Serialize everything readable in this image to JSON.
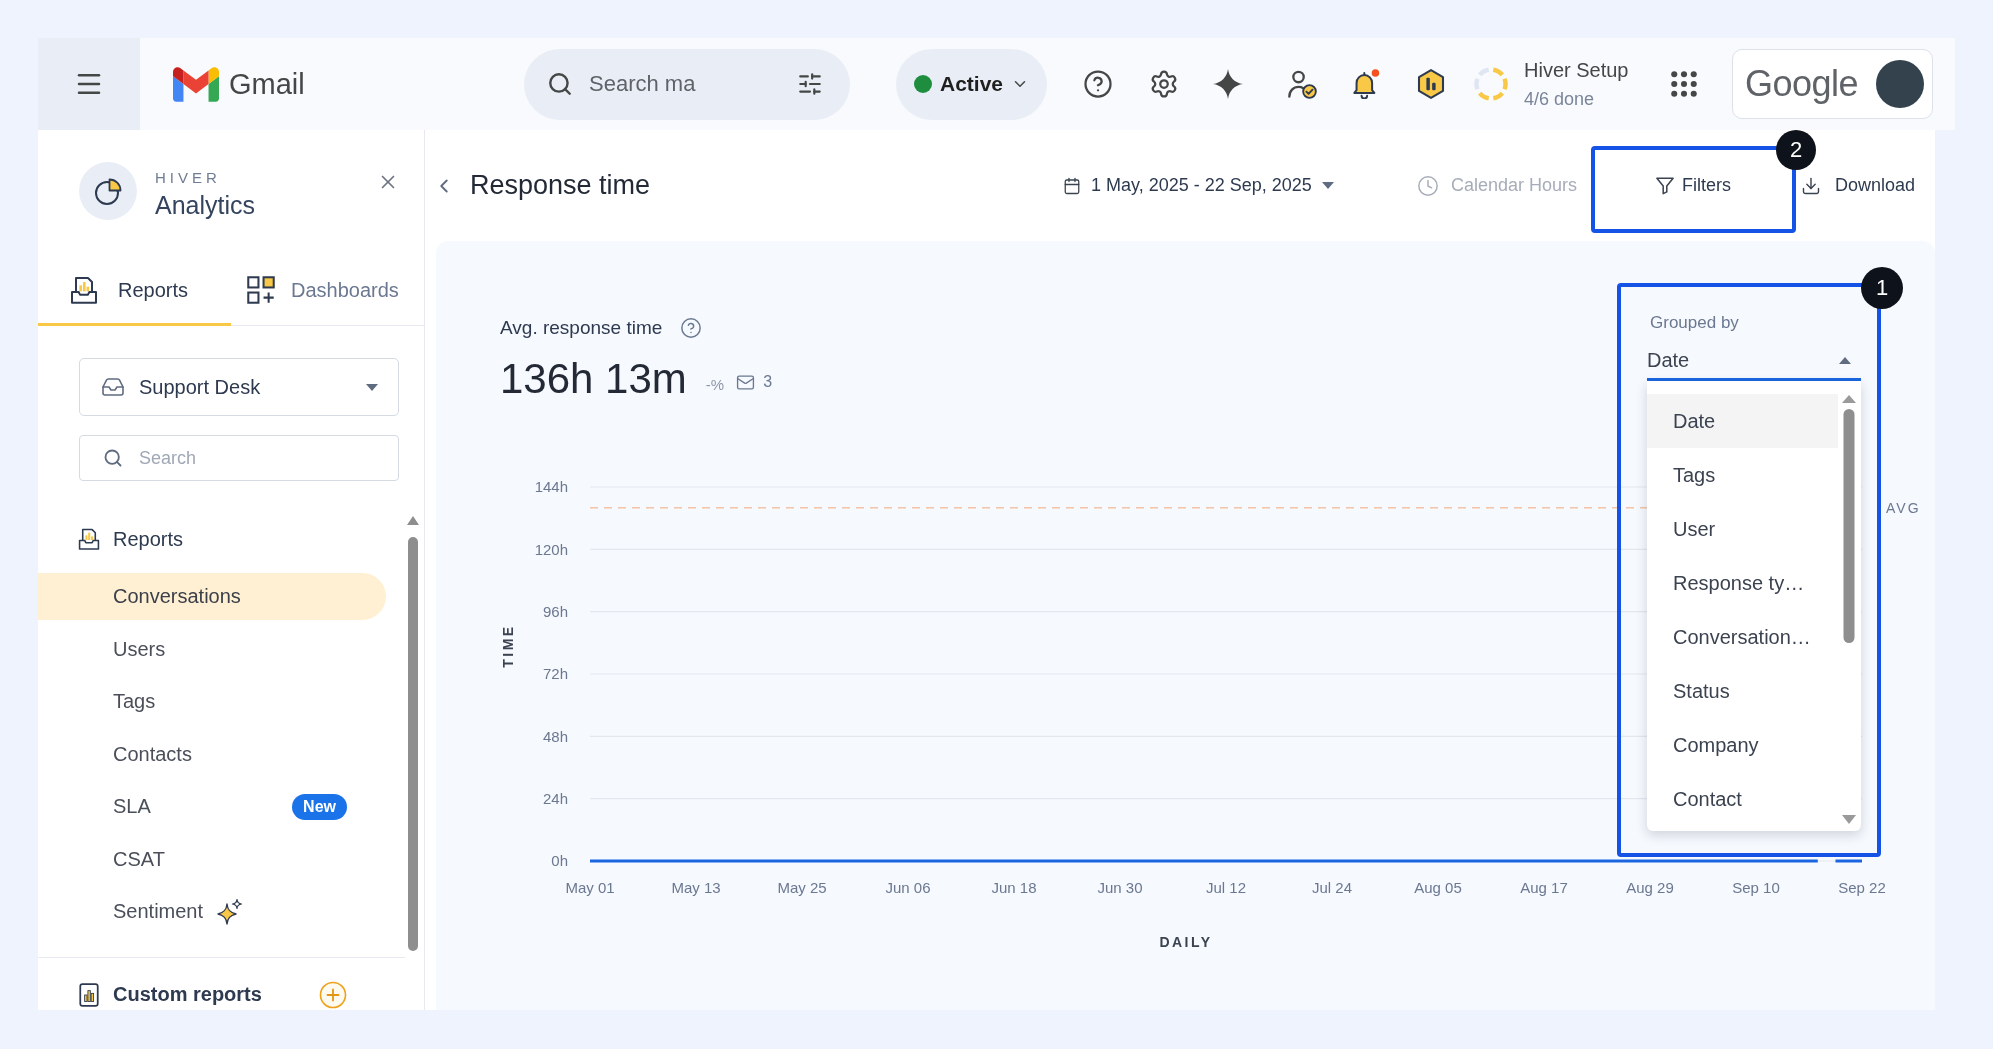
{
  "topbar": {
    "app_name": "Gmail",
    "search": {
      "placeholder": "Search ma"
    },
    "status": {
      "label": "Active",
      "online": true
    },
    "notifications": {
      "unread": true
    },
    "setup": {
      "title": "Hiver Setup",
      "progress": "4/6 done",
      "level": 0.667
    },
    "account": {
      "logo_text": "Google"
    }
  },
  "sidebar": {
    "brand": {
      "kicker": "HIVER",
      "title": "Analytics"
    },
    "tabs": [
      {
        "label": "Reports",
        "selected": true
      },
      {
        "label": "Dashboards",
        "selected": false
      }
    ],
    "inbox_select": {
      "value": "Support Desk"
    },
    "search": {
      "placeholder": "Search"
    },
    "section": {
      "title": "Reports",
      "items": [
        {
          "label": "Conversations",
          "selected": true,
          "sparkle": false
        },
        {
          "label": "Users",
          "selected": false,
          "sparkle": false
        },
        {
          "label": "Tags",
          "selected": false,
          "sparkle": false
        },
        {
          "label": "Contacts",
          "selected": false,
          "sparkle": false
        },
        {
          "label": "SLA",
          "selected": false,
          "sparkle": false,
          "badge": "New"
        },
        {
          "label": "CSAT",
          "selected": false,
          "sparkle": false
        },
        {
          "label": "Sentiment",
          "selected": false,
          "sparkle": true
        }
      ]
    },
    "custom_reports": {
      "title": "Custom reports"
    }
  },
  "report": {
    "title": "Response time",
    "date_range": "1 May, 2025 - 22 Sep, 2025",
    "hours": {
      "label": "Calendar Hours",
      "disabled": true
    },
    "actions": [
      {
        "label": "Filters"
      },
      {
        "label": "Download"
      }
    ]
  },
  "metric": {
    "title": "Avg. response time",
    "value": "136h 13m",
    "change": "-%",
    "count": "3"
  },
  "grouping": {
    "label": "Grouped by",
    "value": "Date",
    "expanded": true,
    "options": [
      {
        "label": "Date",
        "selected": true
      },
      {
        "label": "Tags",
        "selected": false
      },
      {
        "label": "User",
        "selected": false
      },
      {
        "label": "Response ty…",
        "selected": false
      },
      {
        "label": "Conversation…",
        "selected": false
      },
      {
        "label": "Status",
        "selected": false
      },
      {
        "label": "Company",
        "selected": false
      },
      {
        "label": "Contact",
        "selected": false
      }
    ]
  },
  "chart_data": {
    "type": "line",
    "xlabel": "DAILY",
    "ylabel": "TIME",
    "grid": true,
    "categories": [
      "May 01",
      null,
      null,
      null,
      null,
      null,
      null,
      null,
      null,
      null,
      null,
      null,
      "May 13",
      null,
      null,
      null,
      null,
      null,
      null,
      null,
      null,
      null,
      null,
      null,
      "May 25",
      null,
      null,
      null,
      null,
      null,
      null,
      null,
      null,
      null,
      null,
      null,
      "Jun 06",
      null,
      null,
      null,
      null,
      null,
      null,
      null,
      null,
      null,
      null,
      null,
      "Jun 18",
      null,
      null,
      null,
      null,
      null,
      null,
      null,
      null,
      null,
      null,
      null,
      "Jun 30",
      null,
      null,
      null,
      null,
      null,
      null,
      null,
      null,
      null,
      null,
      null,
      "Jul 12",
      null,
      null,
      null,
      null,
      null,
      null,
      null,
      null,
      null,
      null,
      null,
      "Jul 24",
      null,
      null,
      null,
      null,
      null,
      null,
      null,
      null,
      null,
      null,
      null,
      "Aug 05",
      null,
      null,
      null,
      null,
      null,
      null,
      null,
      null,
      null,
      null,
      null,
      "Aug 17",
      null,
      null,
      null,
      null,
      null,
      null,
      null,
      null,
      null,
      null,
      null,
      "Aug 29",
      null,
      null,
      null,
      null,
      null,
      null,
      null,
      null,
      null,
      null,
      null,
      "Sep 10",
      null,
      null,
      null,
      null,
      null,
      null,
      null,
      null,
      null,
      null,
      null,
      "Sep 22"
    ],
    "ylim": [
      0,
      144
    ],
    "yticks": [
      {
        "value": 0,
        "label": "0h"
      },
      {
        "value": 24,
        "label": "24h"
      },
      {
        "value": 48,
        "label": "48h"
      },
      {
        "value": 72,
        "label": "72h"
      },
      {
        "value": 96,
        "label": "96h"
      },
      {
        "value": 120,
        "label": "120h"
      },
      {
        "value": 144,
        "label": "144h"
      }
    ],
    "series": [
      {
        "color": "#1a66e0",
        "values": [
          0,
          0,
          0,
          0,
          0,
          0,
          0,
          0,
          0,
          0,
          0,
          0,
          0,
          0,
          0,
          0,
          0,
          0,
          0,
          0,
          0,
          0,
          0,
          0,
          0,
          0,
          0,
          0,
          0,
          0,
          0,
          0,
          0,
          0,
          0,
          0,
          0,
          0,
          0,
          0,
          0,
          0,
          0,
          0,
          0,
          0,
          0,
          0,
          0,
          0,
          0,
          0,
          0,
          0,
          0,
          0,
          0,
          0,
          0,
          0,
          0,
          0,
          0,
          0,
          0,
          0,
          0,
          0,
          0,
          0,
          0,
          0,
          0,
          0,
          0,
          0,
          0,
          0,
          0,
          0,
          0,
          0,
          0,
          0,
          0,
          0,
          0,
          0,
          0,
          0,
          0,
          0,
          0,
          0,
          0,
          0,
          0,
          0,
          0,
          0,
          0,
          0,
          0,
          0,
          0,
          0,
          0,
          0,
          0,
          0,
          0,
          0,
          0,
          0,
          0,
          0,
          0,
          0,
          0,
          0,
          0,
          0,
          0,
          0,
          0,
          0,
          0,
          0,
          0,
          0,
          0,
          0,
          0,
          0,
          0,
          0,
          0,
          0,
          0,
          0,
          null,
          0,
          0,
          0,
          0
        ]
      }
    ],
    "ref_lines": [
      {
        "axis": "y",
        "value": 136,
        "label": "AVG",
        "color": "#f2c4a5"
      }
    ]
  },
  "callouts": [
    {
      "number": "1"
    },
    {
      "number": "2"
    }
  ]
}
